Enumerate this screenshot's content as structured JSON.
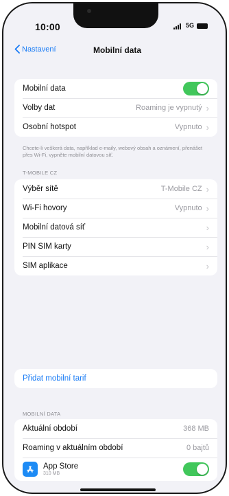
{
  "status": {
    "time": "10:00",
    "network": "5G"
  },
  "nav": {
    "back_label": "Nastavení",
    "title": "Mobilní data"
  },
  "main_group": {
    "mobile_data_label": "Mobilní data",
    "mobile_data_on": true,
    "data_options_label": "Volby dat",
    "data_options_value": "Roaming je vypnutý",
    "hotspot_label": "Osobní hotspot",
    "hotspot_value": "Vypnuto"
  },
  "main_note": "Chcete-li veškerá data, například e-maily, webový obsah a oznámení, přenášet přes Wi-Fi, vypněte mobilní datovou síť.",
  "carrier_section": {
    "header": "T-MOBILE CZ",
    "network_selection_label": "Výběr sítě",
    "network_selection_value": "T-Mobile CZ",
    "wifi_calling_label": "Wi-Fi hovory",
    "wifi_calling_value": "Vypnuto",
    "mobile_data_network_label": "Mobilní datová síť",
    "sim_pin_label": "PIN SIM karty",
    "sim_apps_label": "SIM aplikace"
  },
  "add_plan_label": "Přidat mobilní tarif",
  "usage_section": {
    "header": "MOBILNÍ DATA",
    "current_period_label": "Aktuální období",
    "current_period_value": "368 MB",
    "roaming_label": "Roaming v aktuálním období",
    "roaming_value": "0 bajtů",
    "app_store_label": "App Store",
    "app_store_usage": "310 MB",
    "app_store_on": true
  },
  "colors": {
    "accent": "#1a7cf5",
    "toggle_on": "#41c75b",
    "background": "#f2f2f7"
  }
}
